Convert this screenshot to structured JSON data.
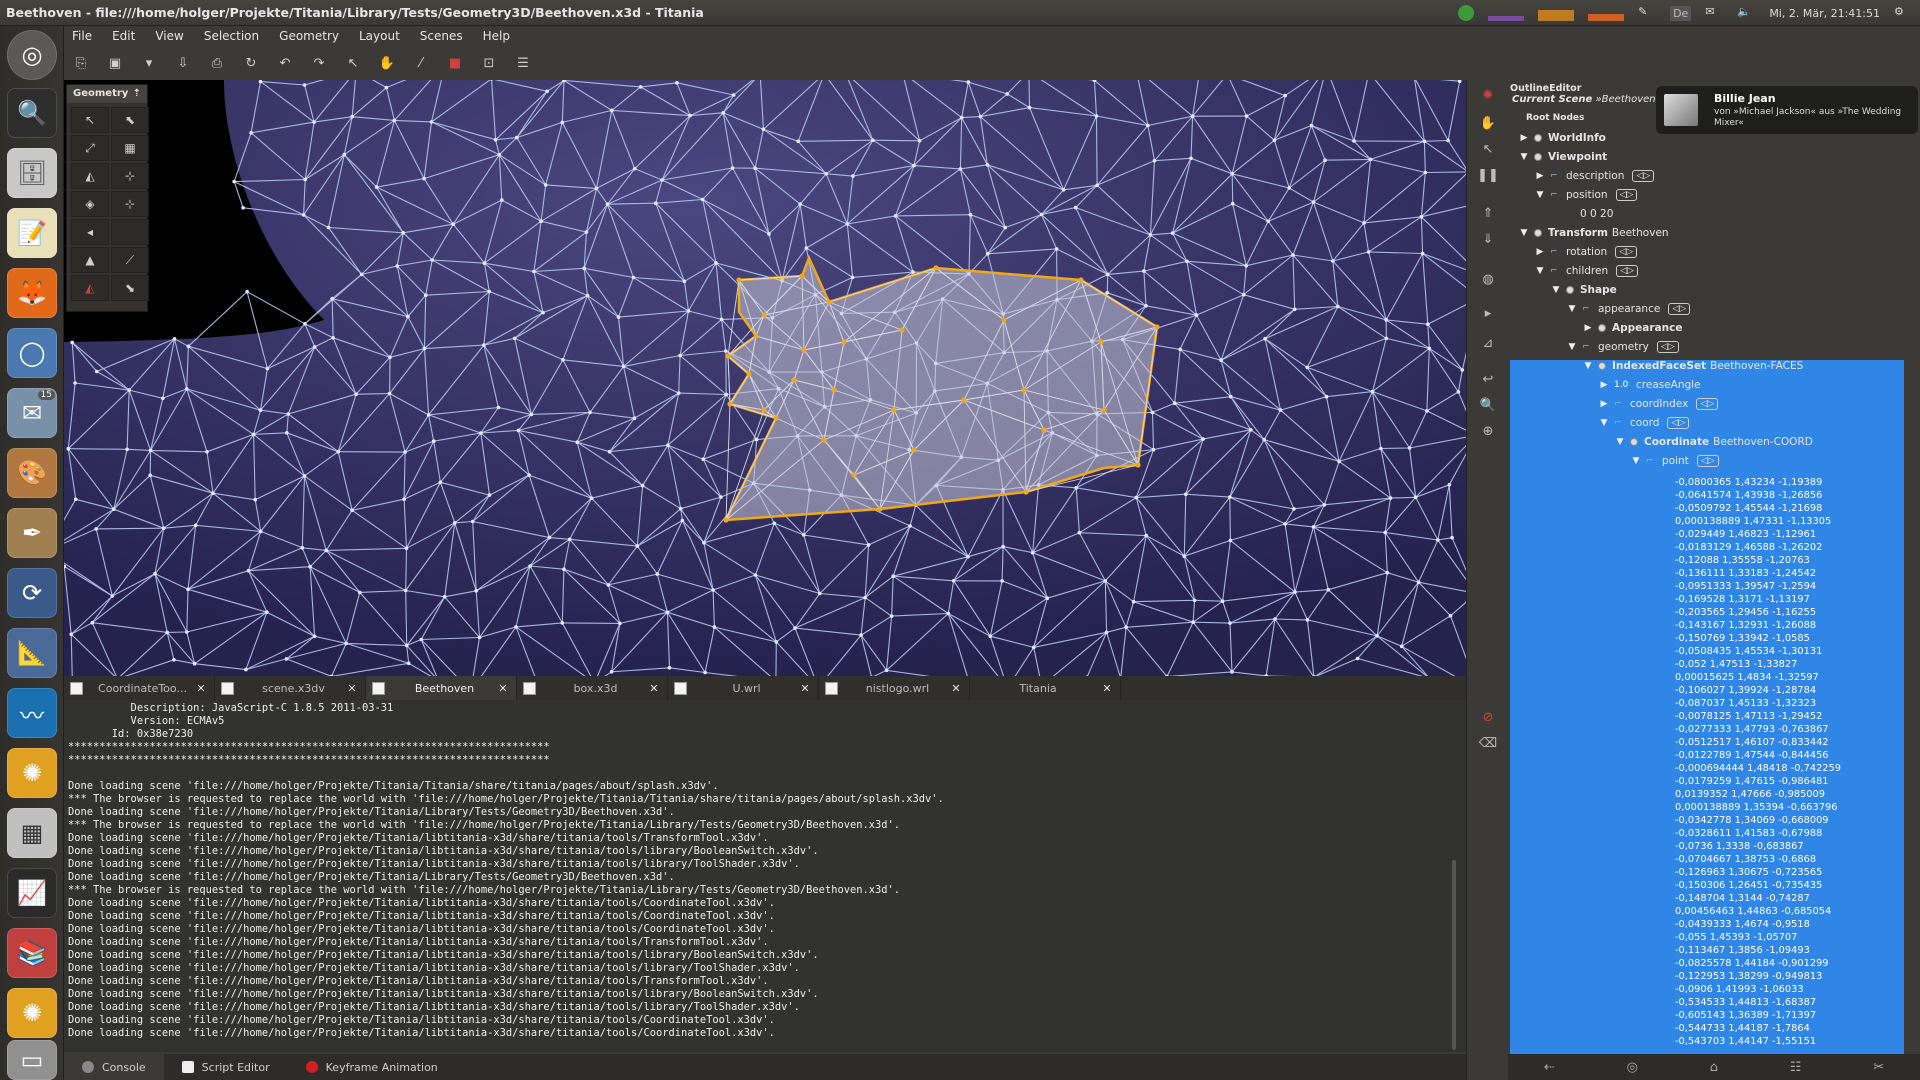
{
  "window": {
    "title": "Beethoven - file:///home/holger/Projekte/Titania/Library/Tests/Geometry3D/Beethoven.x3d - Titania"
  },
  "system": {
    "datetime": "Mi, 2. Mär, 21:41:51",
    "keyboard": "De"
  },
  "menu": [
    "File",
    "Edit",
    "View",
    "Selection",
    "Geometry",
    "Layout",
    "Scenes",
    "Help"
  ],
  "launcher": {
    "badge": "15"
  },
  "geometry_palette": {
    "title": "Geometry"
  },
  "tabs": [
    {
      "label": "CoordinateToo..."
    },
    {
      "label": "scene.x3dv"
    },
    {
      "label": "Beethoven"
    },
    {
      "label": "box.x3d"
    },
    {
      "label": "U.wrl"
    },
    {
      "label": "nistlogo.wrl"
    },
    {
      "label": "Titania"
    }
  ],
  "console": {
    "lines": [
      "          Description: JavaScript-C 1.8.5 2011-03-31",
      "          Version: ECMAv5",
      "       Id: 0x38e7230",
      "*****************************************************************************",
      "*****************************************************************************",
      "",
      "Done loading scene 'file:///home/holger/Projekte/Titania/Titania/share/titania/pages/about/splash.x3dv'.",
      "*** The browser is requested to replace the world with 'file:///home/holger/Projekte/Titania/Titania/share/titania/pages/about/splash.x3dv'.",
      "Done loading scene 'file:///home/holger/Projekte/Titania/Library/Tests/Geometry3D/Beethoven.x3d'.",
      "*** The browser is requested to replace the world with 'file:///home/holger/Projekte/Titania/Library/Tests/Geometry3D/Beethoven.x3d'.",
      "Done loading scene 'file:///home/holger/Projekte/Titania/libtitania-x3d/share/titania/tools/TransformTool.x3dv'.",
      "Done loading scene 'file:///home/holger/Projekte/Titania/libtitania-x3d/share/titania/tools/library/BooleanSwitch.x3dv'.",
      "Done loading scene 'file:///home/holger/Projekte/Titania/libtitania-x3d/share/titania/tools/library/ToolShader.x3dv'.",
      "Done loading scene 'file:///home/holger/Projekte/Titania/Library/Tests/Geometry3D/Beethoven.x3d'.",
      "*** The browser is requested to replace the world with 'file:///home/holger/Projekte/Titania/Library/Tests/Geometry3D/Beethoven.x3d'.",
      "Done loading scene 'file:///home/holger/Projekte/Titania/libtitania-x3d/share/titania/tools/CoordinateTool.x3dv'.",
      "Done loading scene 'file:///home/holger/Projekte/Titania/libtitania-x3d/share/titania/tools/CoordinateTool.x3dv'.",
      "Done loading scene 'file:///home/holger/Projekte/Titania/libtitania-x3d/share/titania/tools/CoordinateTool.x3dv'.",
      "Done loading scene 'file:///home/holger/Projekte/Titania/libtitania-x3d/share/titania/tools/TransformTool.x3dv'.",
      "Done loading scene 'file:///home/holger/Projekte/Titania/libtitania-x3d/share/titania/tools/library/BooleanSwitch.x3dv'.",
      "Done loading scene 'file:///home/holger/Projekte/Titania/libtitania-x3d/share/titania/tools/library/ToolShader.x3dv'.",
      "Done loading scene 'file:///home/holger/Projekte/Titania/libtitania-x3d/share/titania/tools/TransformTool.x3dv'.",
      "Done loading scene 'file:///home/holger/Projekte/Titania/libtitania-x3d/share/titania/tools/library/BooleanSwitch.x3dv'.",
      "Done loading scene 'file:///home/holger/Projekte/Titania/libtitania-x3d/share/titania/tools/library/ToolShader.x3dv'.",
      "Done loading scene 'file:///home/holger/Projekte/Titania/libtitania-x3d/share/titania/tools/CoordinateTool.x3dv'.",
      "Done loading scene 'file:///home/holger/Projekte/Titania/libtitania-x3d/share/titania/tools/CoordinateTool.x3dv'."
    ]
  },
  "bottom_tabs": [
    "Console",
    "Script Editor",
    "Keyframe Animation"
  ],
  "outline": {
    "title": "OutlineEditor",
    "scene_label": "Current Scene",
    "scene_name": "»Beethoven",
    "root_label": "Root Nodes",
    "rows": [
      {
        "text": "WorldInfo",
        "extra": ""
      },
      {
        "text": "Viewpoint",
        "extra": ""
      },
      {
        "text": "description",
        "extra": ""
      },
      {
        "text": "position",
        "extra": ""
      },
      {
        "text": "0 0 20",
        "extra": ""
      },
      {
        "text": "Transform",
        "extra": "Beethoven"
      },
      {
        "text": "rotation",
        "extra": ""
      },
      {
        "text": "children",
        "extra": ""
      },
      {
        "text": "Shape",
        "extra": ""
      },
      {
        "text": "appearance",
        "extra": ""
      },
      {
        "text": "Appearance",
        "extra": ""
      },
      {
        "text": "geometry",
        "extra": ""
      },
      {
        "text": "IndexedFaceSet",
        "extra": "Beethoven-FACES"
      },
      {
        "text": "creaseAngle",
        "extra": ""
      },
      {
        "text": "coordIndex",
        "extra": ""
      },
      {
        "text": "coord",
        "extra": ""
      },
      {
        "text": "Coordinate",
        "extra": "Beethoven-COORD"
      },
      {
        "text": "point",
        "extra": ""
      }
    ],
    "float_badge": "1.0",
    "points": [
      "-0,0800365 1,43234 -1,19389",
      "-0,0641574 1,43938 -1,26856",
      "-0,0509792 1,45544 -1,21698",
      "0,000138889 1,47331 -1,13305",
      "-0,029449 1,46823 -1,12961",
      "-0,0183129 1,46588 -1,26202",
      "-0,12088 1,35558 -1,20763",
      "-0,136111 1,33183 -1,24542",
      "-0,0951333 1,39547 -1,2594",
      "-0,169528 1,3171 -1,13197",
      "-0,203565 1,29456 -1,16255",
      "-0,143167 1,32931 -1,26088",
      "-0,150769 1,33942 -1,0585",
      "-0,0508435 1,45534 -1,30131",
      "-0,052 1,47513 -1,33827",
      "0,00015625 1,4834 -1,32597",
      "-0,106027 1,39924 -1,28784",
      "-0,087037 1,45133 -1,32323",
      "-0,0078125 1,47113 -1,29452",
      "-0,0277333 1,47793 -0,763867",
      "-0,0512517 1,46107 -0,833442",
      "-0,0122789 1,47544 -0,844456",
      "-0,000694444 1,48418 -0,742259",
      "-0,0179259 1,47615 -0,986481",
      "0,0139352 1,47666 -0,985009",
      "0,000138889 1,35394 -0,663796",
      "-0,0342778 1,34069 -0,668009",
      "-0,0328611 1,41583 -0,67988",
      "-0,0736 1,3338 -0,683867",
      "-0,0704667 1,38753 -0,6868",
      "-0,126963 1,30675 -0,723565",
      "-0,150306 1,26451 -0,735435",
      "-0,148704 1,3144 -0,74287",
      "0,00456463 1,44863 -0,685054",
      "-0,0439333 1,4674 -0,9518",
      "-0,055 1,45393 -1,05707",
      "-0,113467 1,3856 -1,09493",
      "-0,0825578 1,44184 -0,901299",
      "-0,122953 1,38299 -0,949813",
      "-0,0906 1,41993 -1,06033",
      "-0,534533 1,44813 -1,68387",
      "-0,605143 1,36389 -1,71397",
      "-0,544733 1,44187 -1,7864",
      "-0,543703 1,44147 -1,55151"
    ]
  },
  "notification": {
    "title": "Billie Jean",
    "body": "von »Michael Jackson« aus »The Wedding Mixer«"
  },
  "colors": {
    "accent_selection": "#2f86e6",
    "viewport_bg": "#2e2a5a",
    "wire": "#b6c7f0",
    "highlight": "#f0a818"
  }
}
